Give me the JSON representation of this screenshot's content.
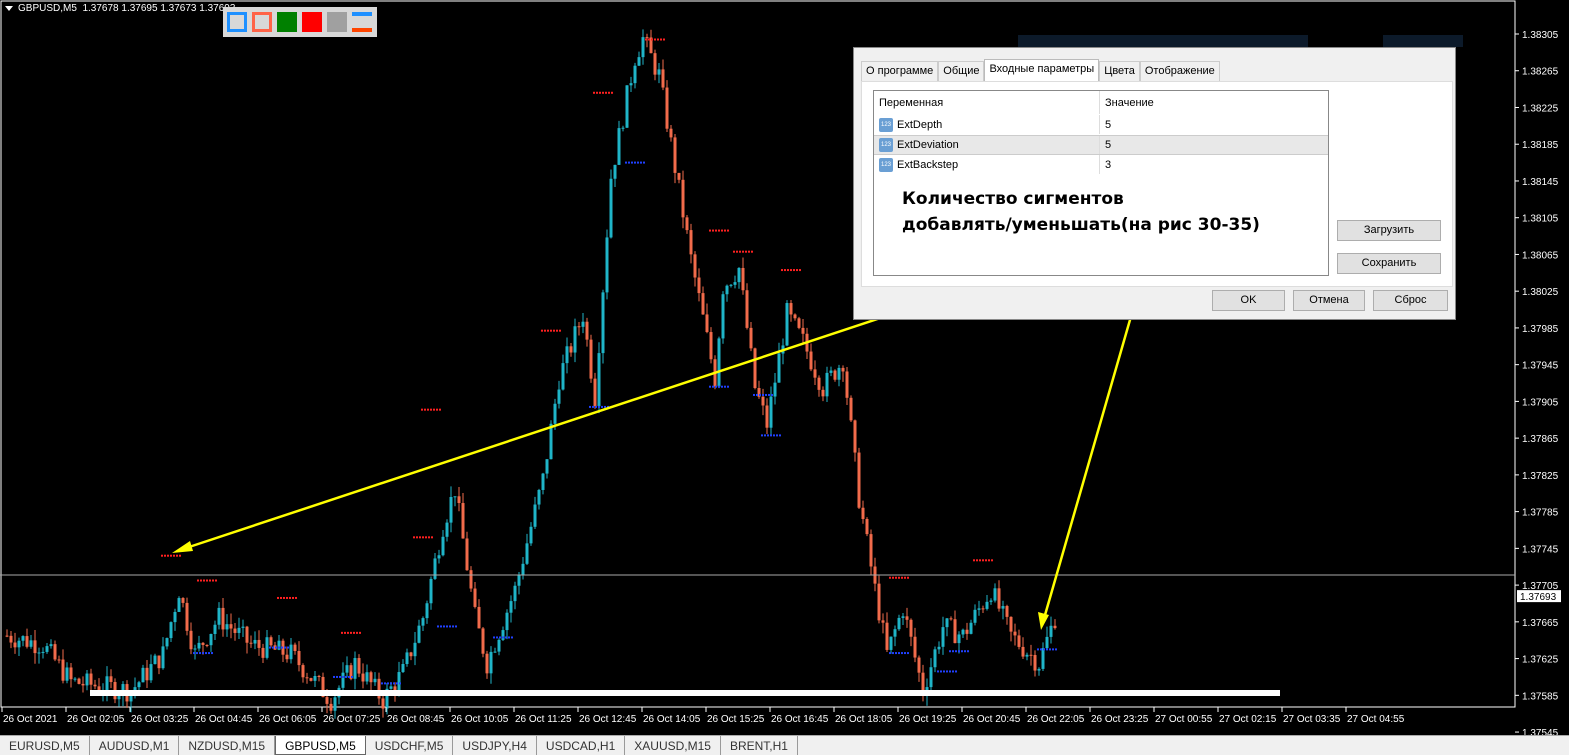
{
  "header": {
    "symbol": "GBPUSD,M5",
    "ohlc": "1.37678 1.37695 1.37673 1.37693"
  },
  "colors": {
    "bull": "#1fb5c8",
    "bear": "#f26b4b",
    "zz_high": "#ff2020",
    "zz_low": "#2040ff",
    "annotation": "#ffff00"
  },
  "price_axis": {
    "labels": [
      "1.38305",
      "1.38265",
      "1.38225",
      "1.38185",
      "1.38145",
      "1.38105",
      "1.38065",
      "1.38025",
      "1.37985",
      "1.37945",
      "1.37905",
      "1.37865",
      "1.37825",
      "1.37785",
      "1.37745",
      "1.37705",
      "1.37665",
      "1.37625",
      "1.37585",
      "1.37545"
    ],
    "current": "1.37693"
  },
  "time_axis": [
    "26 Oct 2021",
    "26 Oct 02:05",
    "26 Oct 03:25",
    "26 Oct 04:45",
    "26 Oct 06:05",
    "26 Oct 07:25",
    "26 Oct 08:45",
    "26 Oct 10:05",
    "26 Oct 11:25",
    "26 Oct 12:45",
    "26 Oct 14:05",
    "26 Oct 15:25",
    "26 Oct 16:45",
    "26 Oct 18:05",
    "26 Oct 19:25",
    "26 Oct 20:45",
    "26 Oct 22:05",
    "26 Oct 23:25",
    "27 Oct 00:55",
    "27 Oct 02:15",
    "27 Oct 03:35",
    "27 Oct 04:55"
  ],
  "price_path": [
    [
      1,
      1.3765
    ],
    [
      10,
      1.3764
    ],
    [
      17,
      1.376
    ],
    [
      32,
      1.3759
    ],
    [
      40,
      1.3763
    ],
    [
      44,
      1.377
    ],
    [
      48,
      1.3763
    ],
    [
      54,
      1.3767
    ],
    [
      62,
      1.3764
    ],
    [
      72,
      1.3763
    ],
    [
      82,
      1.3758
    ],
    [
      88,
      1.3762
    ],
    [
      95,
      1.3758
    ],
    [
      100,
      1.3761
    ],
    [
      105,
      1.3767
    ],
    [
      110,
      1.3777
    ],
    [
      113,
      1.3781
    ],
    [
      118,
      1.3767
    ],
    [
      121,
      1.3762
    ],
    [
      128,
      1.377
    ],
    [
      135,
      1.3782
    ],
    [
      139,
      1.3793
    ],
    [
      145,
      1.38
    ],
    [
      148,
      1.3791
    ],
    [
      152,
      1.3815
    ],
    [
      158,
      1.3828
    ],
    [
      160,
      1.383
    ],
    [
      164,
      1.3826
    ],
    [
      168,
      1.3816
    ],
    [
      172,
      1.3806
    ],
    [
      178,
      1.3793
    ],
    [
      180,
      1.3803
    ],
    [
      184,
      1.3805
    ],
    [
      188,
      1.3792
    ],
    [
      191,
      1.3788
    ],
    [
      196,
      1.38
    ],
    [
      200,
      1.3797
    ],
    [
      205,
      1.3792
    ],
    [
      210,
      1.3795
    ],
    [
      214,
      1.378
    ],
    [
      218,
      1.377
    ],
    [
      221,
      1.3763
    ],
    [
      225,
      1.3768
    ],
    [
      230,
      1.3759
    ],
    [
      235,
      1.3766
    ],
    [
      240,
      1.3765
    ],
    [
      247,
      1.377
    ],
    [
      252,
      1.3765
    ],
    [
      259,
      1.3762
    ],
    [
      263,
      1.3767
    ]
  ],
  "zigzag": [
    [
      "h",
      42,
      1.37737
    ],
    [
      "l",
      50,
      1.37631
    ],
    [
      "h",
      51,
      1.3771
    ],
    [
      "h",
      71,
      1.37691
    ],
    [
      "l",
      69,
      1.37637
    ],
    [
      "h",
      87,
      1.37653
    ],
    [
      "l",
      85,
      1.37605
    ],
    [
      "l",
      97,
      1.37598
    ],
    [
      "h",
      107,
      1.37896
    ],
    [
      "h",
      105,
      1.37757
    ],
    [
      "l",
      111,
      1.3766
    ],
    [
      "l",
      125,
      1.37648
    ],
    [
      "h",
      137,
      1.37982
    ],
    [
      "l",
      149,
      1.37899
    ],
    [
      "h",
      150,
      1.38241
    ],
    [
      "l",
      158,
      1.38165
    ],
    [
      "h",
      163,
      1.38299
    ],
    [
      "h",
      179,
      1.38091
    ],
    [
      "l",
      179,
      1.37921
    ],
    [
      "h",
      185,
      1.38068
    ],
    [
      "l",
      190,
      1.37912
    ],
    [
      "l",
      192,
      1.37868
    ],
    [
      "h",
      197,
      1.38048
    ],
    [
      "h",
      224,
      1.37713
    ],
    [
      "l",
      224,
      1.37631
    ],
    [
      "l",
      236,
      1.37611
    ],
    [
      "l",
      239,
      1.37633
    ],
    [
      "h",
      245,
      1.37732
    ],
    [
      "l",
      261,
      1.37635
    ]
  ],
  "tabs": [
    "EURUSD,M5",
    "AUDUSD,M1",
    "NZDUSD,M15",
    "GBPUSD,M5",
    "USDCHF,M5",
    "USDJPY,H4",
    "USDCAD,H1",
    "XAUUSD,M15",
    "BRENT,H1"
  ],
  "dialog": {
    "tabs": [
      "О программе",
      "Общие",
      "Входные параметры",
      "Цвета",
      "Отображение"
    ],
    "col_variable": "Переменная",
    "col_value": "Значение",
    "params": [
      {
        "name": "ExtDepth",
        "value": "5"
      },
      {
        "name": "ExtDeviation",
        "value": "5"
      },
      {
        "name": "ExtBackstep",
        "value": "3"
      }
    ],
    "param_icon": "123",
    "note_line1": "Количество сигментов",
    "note_line2": "добавлять/уменьшать(на рис 30-35)",
    "load": "Загрузить",
    "save": "Сохранить",
    "ok": "OK",
    "cancel": "Отмена",
    "reset": "Сброс"
  }
}
